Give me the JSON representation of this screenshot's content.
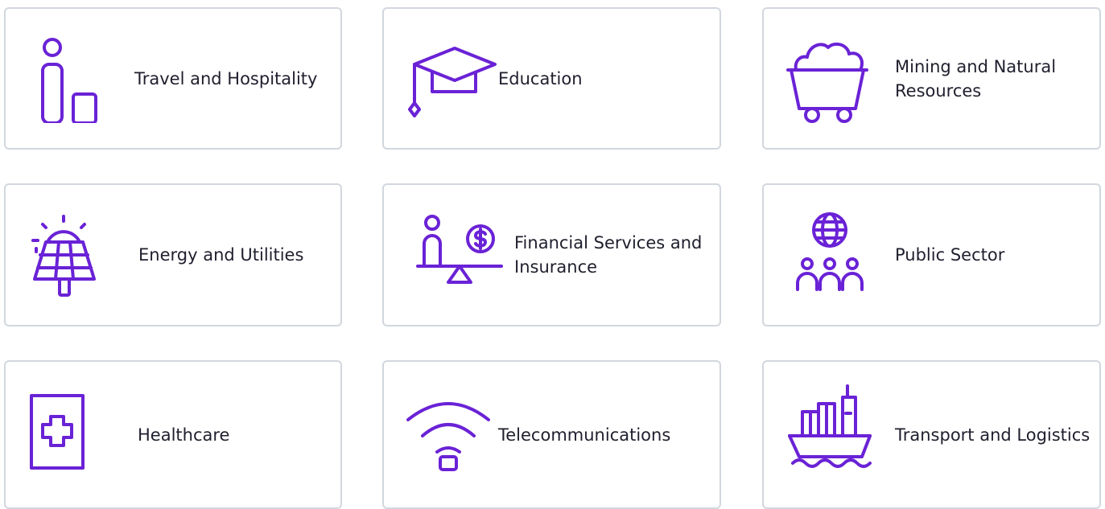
{
  "accent_color": "#6a22d6",
  "cards": [
    {
      "label": "Travel and Hospitality",
      "icon": "traveler-luggage-icon"
    },
    {
      "label": "Education",
      "icon": "graduation-cap-icon"
    },
    {
      "label": "Mining and Natural Resources",
      "icon": "mine-cart-icon"
    },
    {
      "label": "Energy and Utilities",
      "icon": "solar-panel-icon"
    },
    {
      "label": "Financial Services and Insurance",
      "icon": "person-balance-dollar-icon"
    },
    {
      "label": "Public Sector",
      "icon": "globe-people-icon"
    },
    {
      "label": "Healthcare",
      "icon": "medical-cross-icon"
    },
    {
      "label": "Telecommunications",
      "icon": "wifi-signal-icon"
    },
    {
      "label": "Transport and Logistics",
      "icon": "cargo-ship-icon"
    }
  ]
}
